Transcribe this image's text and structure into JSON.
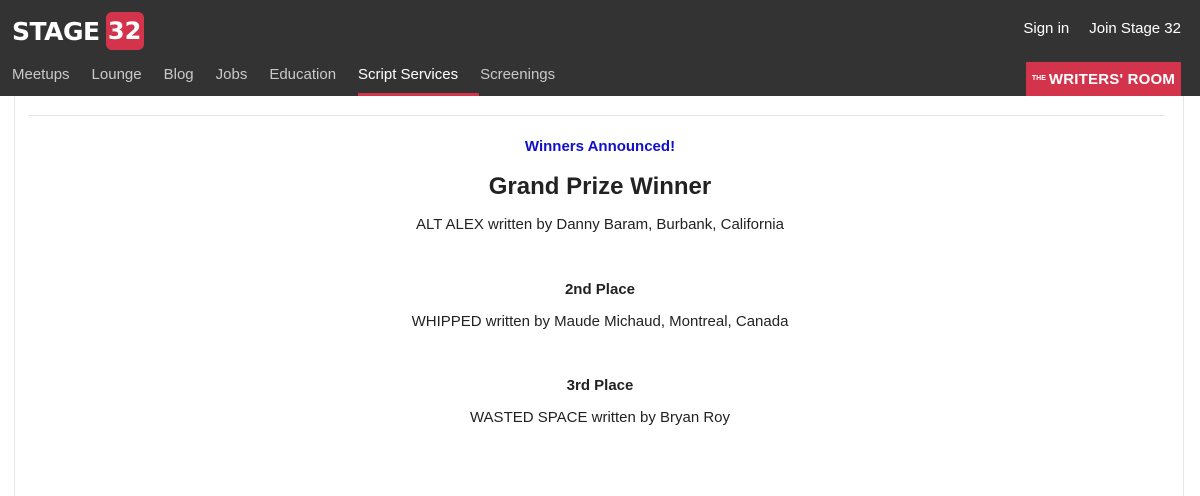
{
  "header": {
    "logo_text": "STAGE",
    "logo_badge": "32",
    "sign_in": "Sign in",
    "join": "Join Stage 32",
    "nav": [
      "Meetups",
      "Lounge",
      "Blog",
      "Jobs",
      "Education",
      "Script Services",
      "Screenings"
    ],
    "active_nav": "Script Services",
    "writers_room_the": "THE",
    "writers_room_text": "WRITERS' ROOM"
  },
  "main": {
    "winners_announced": "Winners Announced!",
    "grand_prize_heading": "Grand Prize Winner",
    "grand_prize_entry": "ALT ALEX written by Danny Baram, Burbank, California",
    "second_place_heading": "2nd Place",
    "second_place_entry": "WHIPPED written by Maude Michaud, Montreal, Canada",
    "third_place_heading": "3rd Place",
    "third_place_entry": "WASTED SPACE written by Bryan Roy"
  },
  "colors": {
    "header_bg": "#333333",
    "brand_red": "#d4344b",
    "announcement_blue": "#1010c8"
  }
}
